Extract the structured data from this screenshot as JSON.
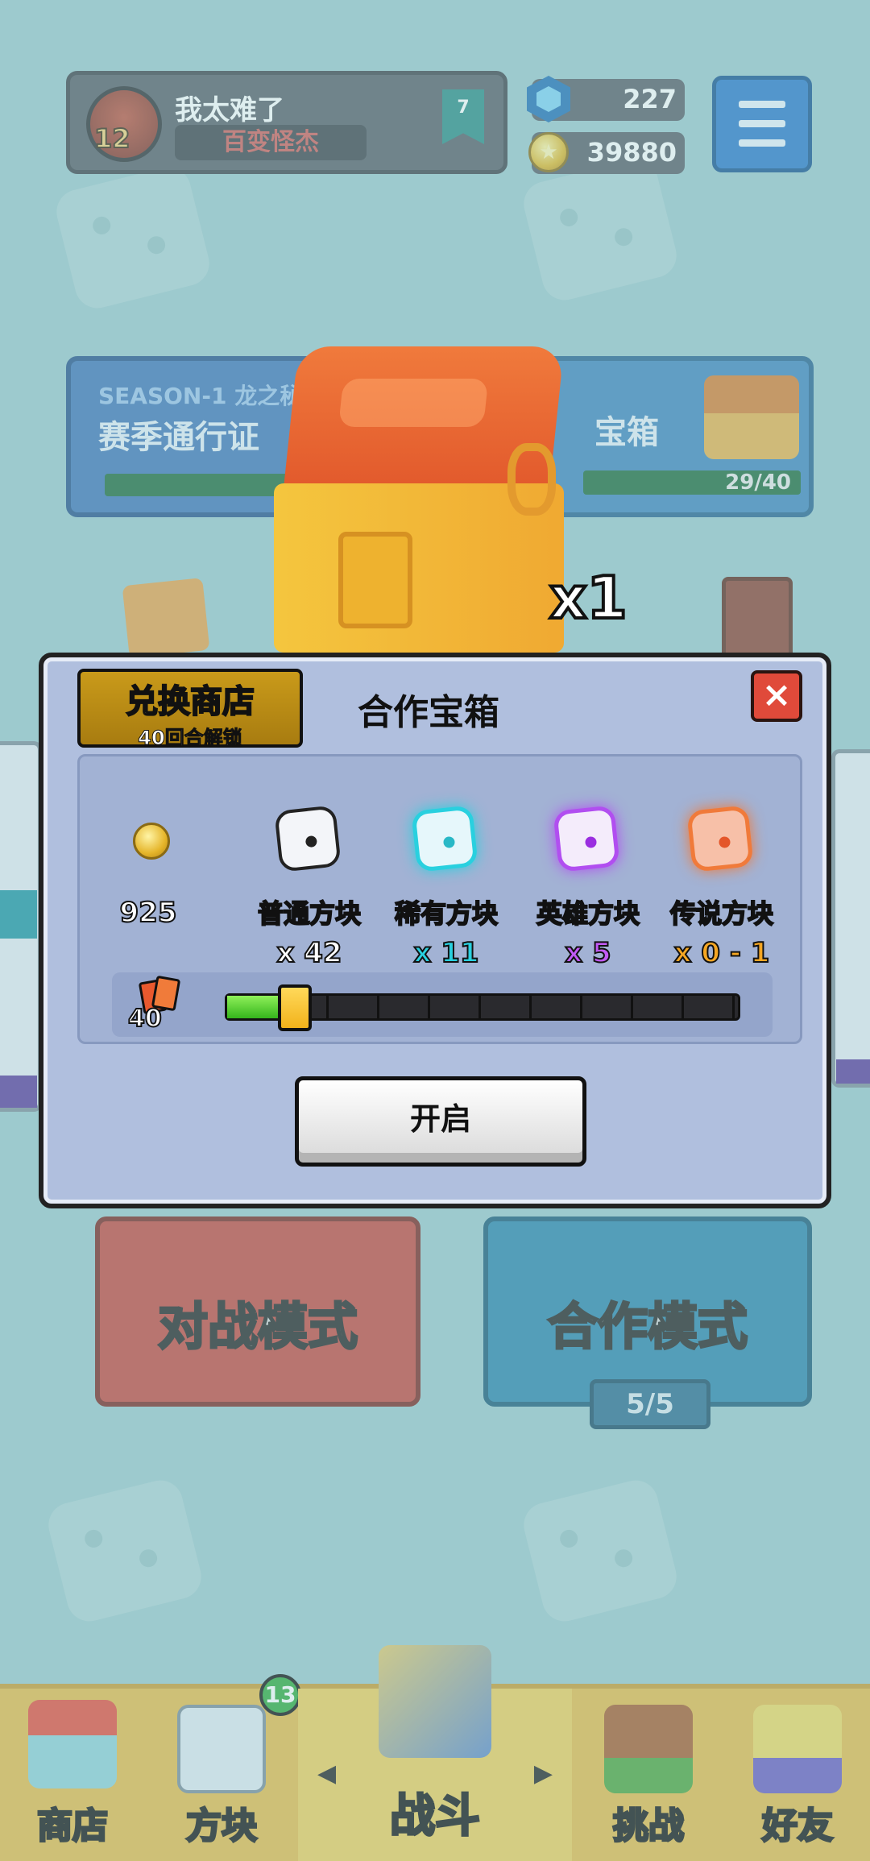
{
  "player": {
    "name": "我太难了",
    "title": "百变怪杰",
    "level": "12",
    "rank": "7"
  },
  "currency": {
    "gems": "227",
    "coins": "39880"
  },
  "season": {
    "label": "SEASON-1 龙之秘",
    "title": "赛季通行证"
  },
  "coop_chest_card": {
    "title": "宝箱",
    "progress": "29/40"
  },
  "chest": {
    "quantity": "x1"
  },
  "modal": {
    "shop_badge_title": "兑换商店",
    "shop_badge_sub": "40回合解锁",
    "title": "合作宝箱",
    "close_icon": "×",
    "rewards": [
      {
        "name": "",
        "qty": "925",
        "color": "#f2c12e"
      },
      {
        "name": "普通方块",
        "qty": "x 42",
        "color": "#ffffff"
      },
      {
        "name": "稀有方块",
        "qty": "x 11",
        "color": "#29d0df"
      },
      {
        "name": "英雄方块",
        "qty": "x 5",
        "color": "#b14ef0"
      },
      {
        "name": "传说方块",
        "qty": "x 0 - 1",
        "color": "#f07a3a"
      }
    ],
    "wave_count": "40",
    "slider_progress": 0.1,
    "open_label": "开启"
  },
  "modes": {
    "battle": "对战模式",
    "coop": "合作模式",
    "coop_count": "5/5"
  },
  "nav": {
    "items": [
      {
        "label": "商店"
      },
      {
        "label": "方块",
        "badge": "13"
      },
      {
        "label": "战斗"
      },
      {
        "label": "挑战"
      },
      {
        "label": "好友"
      }
    ]
  }
}
